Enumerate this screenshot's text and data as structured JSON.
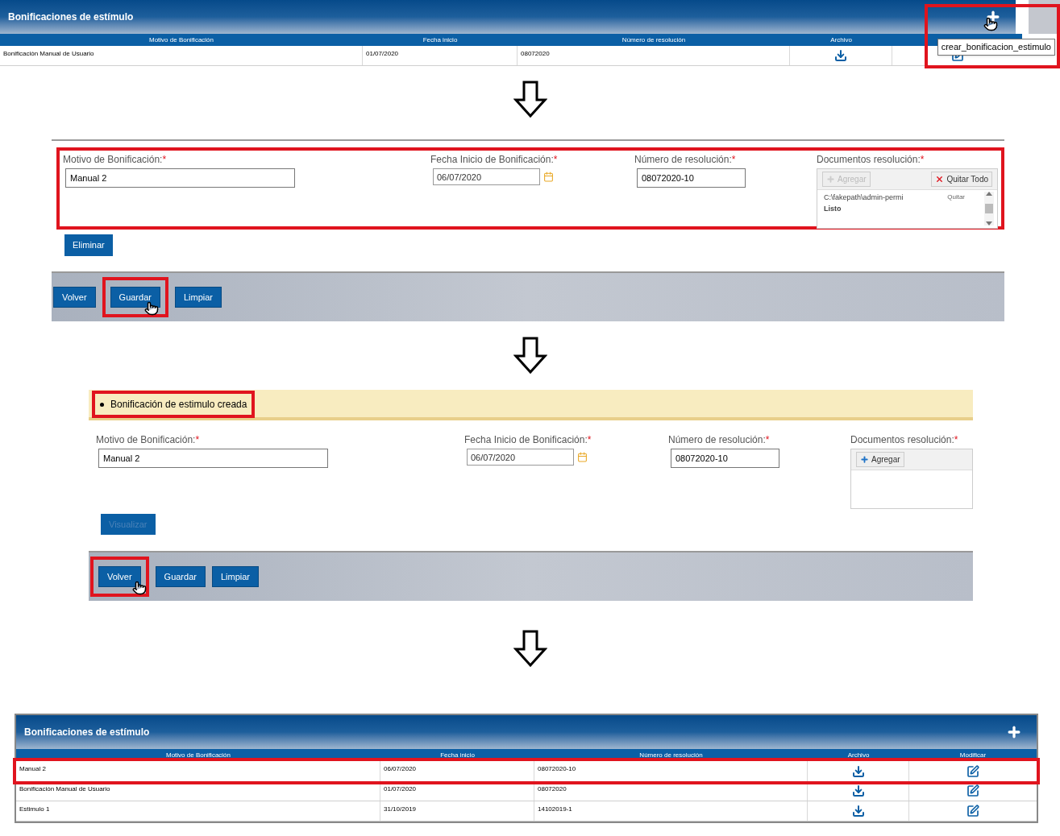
{
  "table_before": {
    "title": "Bonificaciones de estímulo",
    "add_highlighted": true,
    "tooltip": "crear_bonificacion_estimulo",
    "columns": [
      "Motivo de Bonificación",
      "Fecha inicio",
      "Número de resolución",
      "Archivo",
      ""
    ],
    "rows": [
      {
        "cells": [
          "Bonificación Manual de Usuario",
          "01/07/2020",
          "08072020"
        ],
        "highlighted": false
      }
    ]
  },
  "form_edit": {
    "highlighted": true,
    "fields": [
      {
        "label": "Motivo de Bonificación:",
        "required": "*",
        "value": "Manual 2",
        "kind": "text"
      },
      {
        "label": "Fecha Inicio de Bonificación:",
        "required": "*",
        "value": "06/07/2020",
        "kind": "date"
      },
      {
        "label": "Número de resolución:",
        "required": "*",
        "value": "08072020-10",
        "kind": "text"
      }
    ],
    "documents": {
      "label": "Documentos resolución:",
      "required": "*",
      "add": {
        "label": "Agregar",
        "disabled": true
      },
      "remove_all": "Quitar Todo",
      "files": [
        {
          "path": "C:\\fakepath\\admin-permi",
          "remove": "Quitar",
          "status": "Listo"
        }
      ]
    },
    "action": {
      "label": "Eliminar",
      "disabled": false
    },
    "footer_buttons": [
      {
        "label": "Volver",
        "highlighted": false
      },
      {
        "label": "Guardar",
        "highlighted": true
      },
      {
        "label": "Limpiar",
        "highlighted": false
      }
    ]
  },
  "form_saved": {
    "message": "Bonificación de estimulo creada",
    "message_highlighted": true,
    "fields": [
      {
        "label": "Motivo de Bonificación:",
        "required": "*",
        "value": "Manual 2",
        "kind": "text"
      },
      {
        "label": "Fecha Inicio de Bonificación:",
        "required": "*",
        "value": "06/07/2020",
        "kind": "date"
      },
      {
        "label": "Número de resolución:",
        "required": "*",
        "value": "08072020-10",
        "kind": "text"
      }
    ],
    "documents": {
      "label": "Documentos resolución:",
      "required": "*",
      "add": {
        "label": "Agregar",
        "disabled": false
      }
    },
    "action": {
      "label": "Visualizar",
      "disabled": true
    },
    "footer_buttons": [
      {
        "label": "Volver",
        "highlighted": true
      },
      {
        "label": "Guardar",
        "highlighted": false
      },
      {
        "label": "Limpiar",
        "highlighted": false
      }
    ]
  },
  "table_after": {
    "title": "Bonificaciones de estímulo",
    "add_highlighted": false,
    "columns": [
      "Motivo de Bonificación",
      "Fecha inicio",
      "Número de resolución",
      "Archivo",
      "Modificar"
    ],
    "rows": [
      {
        "cells": [
          "Manual 2",
          "06/07/2020",
          "08072020-10"
        ],
        "highlighted": true
      },
      {
        "cells": [
          "Bonificación Manual de Usuario",
          "01/07/2020",
          "08072020"
        ],
        "highlighted": false
      },
      {
        "cells": [
          "Estimulo 1",
          "31/10/2019",
          "14102019-1"
        ],
        "highlighted": false
      }
    ]
  }
}
